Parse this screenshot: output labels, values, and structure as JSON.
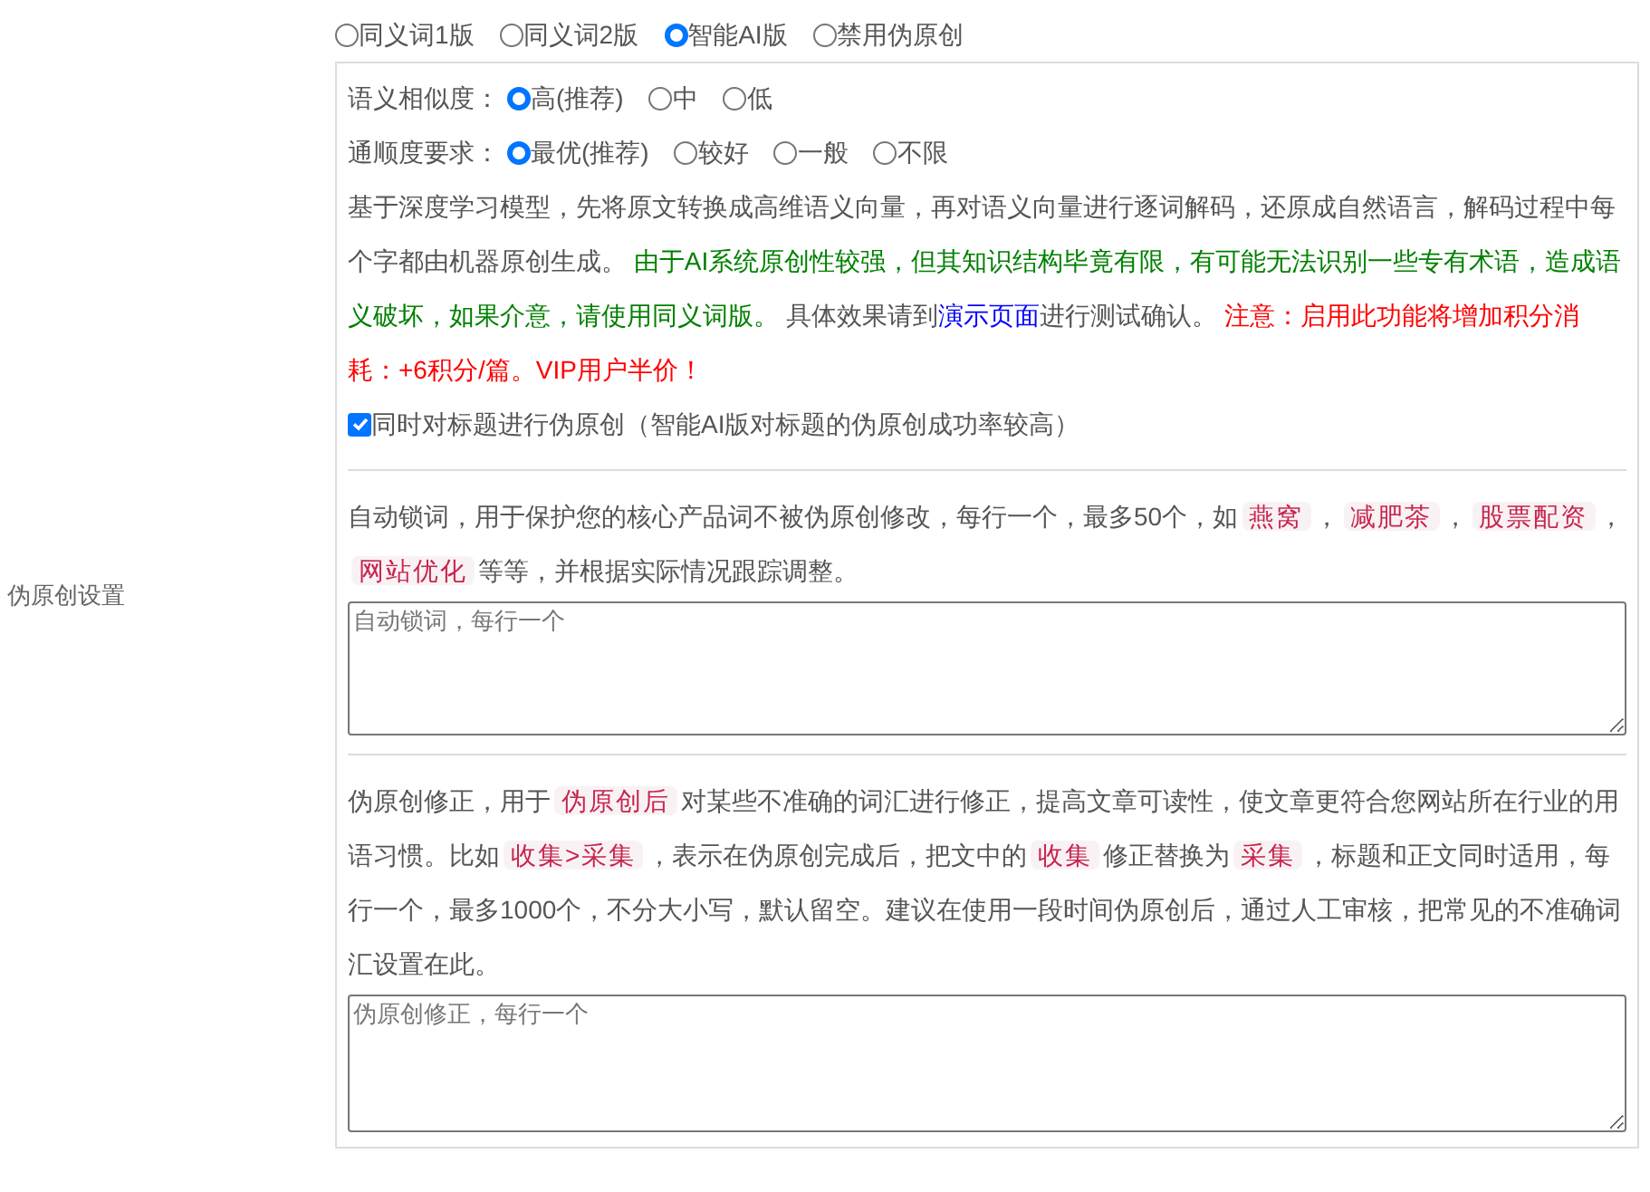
{
  "mode_options": [
    {
      "label": "同义词1版",
      "selected": false
    },
    {
      "label": "同义词2版",
      "selected": false
    },
    {
      "label": "智能AI版",
      "selected": true
    },
    {
      "label": "禁用伪原创",
      "selected": false
    }
  ],
  "similarity": {
    "label": "语义相似度：",
    "options": [
      {
        "label": "高(推荐)",
        "selected": true
      },
      {
        "label": "中",
        "selected": false
      },
      {
        "label": "低",
        "selected": false
      }
    ]
  },
  "fluency": {
    "label": "通顺度要求：",
    "options": [
      {
        "label": "最优(推荐)",
        "selected": true
      },
      {
        "label": "较好",
        "selected": false
      },
      {
        "label": "一般",
        "selected": false
      },
      {
        "label": "不限",
        "selected": false
      }
    ]
  },
  "ai_description": [
    {
      "kind": "plain",
      "text": "基于深度学习模型，先将原文转换成高维语义向量，再对语义向量进行逐词解码，还原成自然语言，解码过程中每个字都由机器原创生成。 "
    },
    {
      "kind": "green",
      "text": "由于AI系统原创性较强，但其知识结构毕竟有限，有可能无法识别一些专有术语，造成语义破坏，如果介意，请使用同义词版。"
    },
    {
      "kind": "plain",
      "text": " 具体效果请到"
    },
    {
      "kind": "link",
      "text": "演示页面"
    },
    {
      "kind": "plain",
      "text": "进行测试确认。 "
    },
    {
      "kind": "red",
      "text": "注意：启用此功能将增加积分消耗：+6积分/篇。VIP用户半价！"
    }
  ],
  "title_option": {
    "label": "同时对标题进行伪原创（智能AI版对标题的伪原创成功率较高）",
    "checked": true
  },
  "section_label": "伪原创设置",
  "lock_words": {
    "description": [
      {
        "kind": "plain",
        "text": "自动锁词，用于保护您的核心产品词不被伪原创修改，每行一个，最多50个，如"
      },
      {
        "kind": "tag",
        "text": "燕窝"
      },
      {
        "kind": "plain",
        "text": "，"
      },
      {
        "kind": "tag",
        "text": "减肥茶"
      },
      {
        "kind": "plain",
        "text": "，"
      },
      {
        "kind": "tag",
        "text": "股票配资"
      },
      {
        "kind": "plain",
        "text": "，"
      },
      {
        "kind": "tag",
        "text": "网站优化"
      },
      {
        "kind": "plain",
        "text": "等等，并根据实际情况跟踪调整。"
      }
    ],
    "placeholder": "自动锁词，每行一个"
  },
  "corrections": {
    "description": [
      {
        "kind": "plain",
        "text": "伪原创修正，用于"
      },
      {
        "kind": "tag",
        "text": "伪原创后"
      },
      {
        "kind": "plain",
        "text": "对某些不准确的词汇进行修正，提高文章可读性，使文章更符合您网站所在行业的用语习惯。比如"
      },
      {
        "kind": "tag",
        "text": "收集>采集"
      },
      {
        "kind": "plain",
        "text": "，表示在伪原创完成后，把文中的"
      },
      {
        "kind": "tag",
        "text": "收集"
      },
      {
        "kind": "plain",
        "text": "修正替换为"
      },
      {
        "kind": "tag",
        "text": "采集"
      },
      {
        "kind": "plain",
        "text": "，标题和正文同时适用，每行一个，最多1000个，不分大小写，默认留空。建议在使用一段时间伪原创后，通过人工审核，把常见的不准确词汇设置在此。"
      }
    ],
    "placeholder": "伪原创修正，每行一个"
  }
}
